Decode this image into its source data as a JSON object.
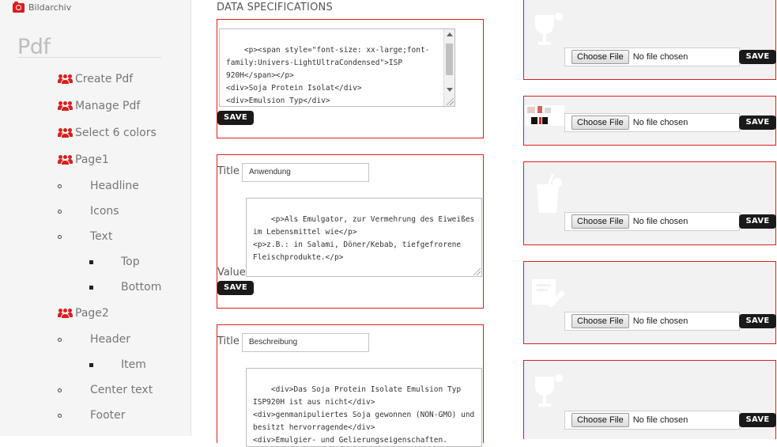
{
  "sidebar": {
    "top_link": "Bildarchiv",
    "title": "Pdf",
    "items": [
      {
        "label": "Create Pdf",
        "icon": "users-icon"
      },
      {
        "label": "Manage Pdf",
        "icon": "users-icon"
      },
      {
        "label": "Select 6 colors",
        "icon": "users-icon"
      },
      {
        "label": "Page1",
        "icon": "users-icon"
      },
      {
        "label": "Headline",
        "bullet": "circle"
      },
      {
        "label": "Icons",
        "bullet": "circle"
      },
      {
        "label": "Text",
        "bullet": "circle"
      },
      {
        "label": "Top",
        "bullet": "square"
      },
      {
        "label": "Bottom",
        "bullet": "square"
      },
      {
        "label": "Page2",
        "icon": "users-icon"
      },
      {
        "label": "Header",
        "bullet": "circle"
      },
      {
        "label": "Item",
        "bullet": "square"
      },
      {
        "label": "Center text",
        "bullet": "circle"
      },
      {
        "label": "Footer",
        "bullet": "circle"
      }
    ]
  },
  "main": {
    "section_title": "DATA SPECIFICATIONS",
    "spec_block": {
      "code": "<p><span style=\"font-size: xx-large;font-family:Univers-LightUltraCondensed\">ISP 920H</span></p>\n<div>Soja Protein Isolat</div>\n<div>Emulsion Typ</div>\n<div> </div>",
      "save_label": "SAVE"
    },
    "field_blocks": [
      {
        "title_label": "Title",
        "title_value": "Anwendung",
        "value_label": "Value",
        "value_code": "<p>Als Emulgator, zur Vermehrung des Eiweißes im Lebensmittel wie</p>\n<p>z.B.: in Salami, Döner/Kebab, tiefgefrorene Fleischprodukte.</p>",
        "save_label": "SAVE"
      },
      {
        "title_label": "Title",
        "title_value": "Beschreibung",
        "value_code": "<div>Das Soja Protein Isolate Emulsion Typ ISP920H ist aus nicht</div>\n<div>genmanipuliertes Soja gewonnen (NON-GMO) und besitzt hervorragende</div>\n<div>Emulgier- und Gelierungseigenschaften.\n</div>"
      }
    ]
  },
  "image_uploads": [
    {
      "icon": "goblet-icon",
      "choose_label": "Choose File",
      "status": "No file chosen",
      "save_label": "SAVE"
    },
    {
      "icon": "thumbnail-image",
      "choose_label": "Choose File",
      "status": "No file chosen",
      "save_label": "SAVE"
    },
    {
      "icon": "drink-icon",
      "choose_label": "Choose File",
      "status": "No file chosen",
      "save_label": "SAVE"
    },
    {
      "icon": "check-badge-icon",
      "choose_label": "Choose File",
      "status": "No file chosen",
      "save_label": "SAVE"
    },
    {
      "icon": "goblet-icon",
      "choose_label": "Choose File",
      "status": "No file chosen",
      "save_label": "SAVE"
    }
  ],
  "colors": {
    "accent": "#d9201e",
    "button": "#1a1a1a"
  }
}
